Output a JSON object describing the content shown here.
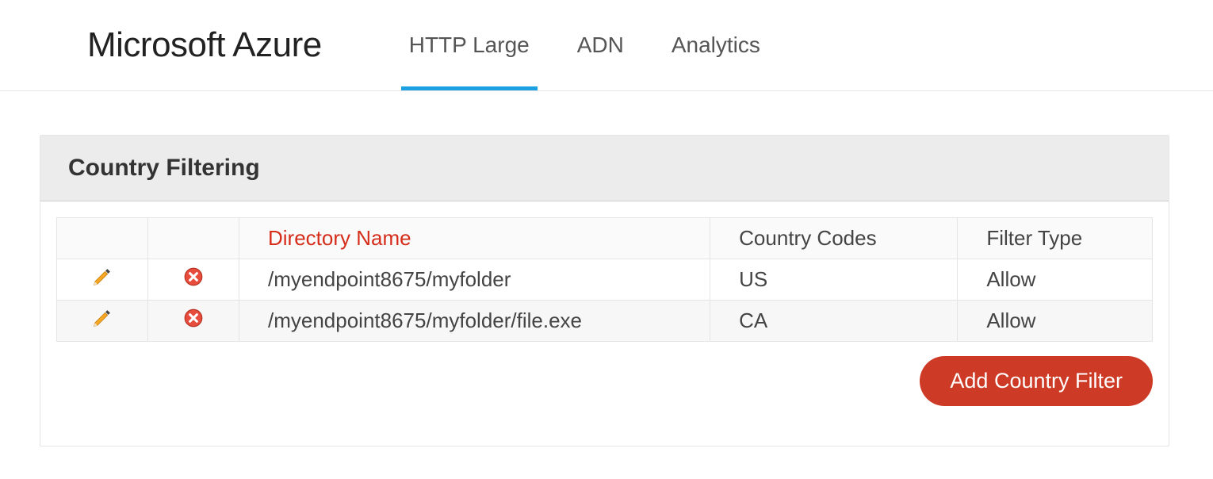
{
  "header": {
    "logo_text": "Microsoft Azure",
    "tabs": [
      {
        "label": "HTTP Large",
        "active": true
      },
      {
        "label": "ADN",
        "active": false
      },
      {
        "label": "Analytics",
        "active": false
      }
    ]
  },
  "panel": {
    "title": "Country Filtering",
    "columns": {
      "directory_name": "Directory Name",
      "country_codes": "Country Codes",
      "filter_type": "Filter Type"
    },
    "rows": [
      {
        "directory": "/myendpoint8675/myfolder",
        "codes": "US",
        "filter": "Allow"
      },
      {
        "directory": "/myendpoint8675/myfolder/file.exe",
        "codes": "CA",
        "filter": "Allow"
      }
    ],
    "add_button_label": "Add Country Filter"
  },
  "icons": {
    "edit": "pencil-icon",
    "delete": "delete-icon"
  }
}
